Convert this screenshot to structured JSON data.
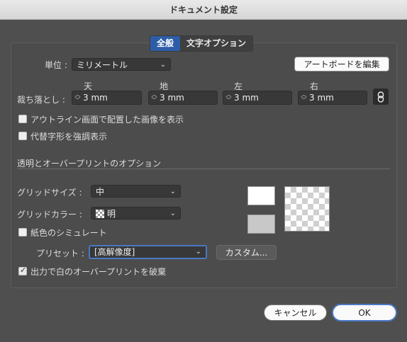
{
  "window": {
    "title": "ドキュメント設定"
  },
  "tabs": [
    {
      "label": "全般",
      "active": true
    },
    {
      "label": "文字オプション",
      "active": false
    }
  ],
  "units": {
    "label": "単位 :",
    "value": "ミリメートル"
  },
  "edit_artboards_button": "アートボードを編集",
  "bleed": {
    "label": "裁ち落とし :",
    "fields": [
      {
        "header": "天",
        "value": "3 mm"
      },
      {
        "header": "地",
        "value": "3 mm"
      },
      {
        "header": "左",
        "value": "3 mm"
      },
      {
        "header": "右",
        "value": "3 mm"
      }
    ],
    "link_icon": "chain-link-icon"
  },
  "checkboxes": {
    "show_images_outline": {
      "label": "アウトライン画面で配置した画像を表示",
      "checked": false
    },
    "highlight_substituted_glyphs": {
      "label": "代替字形を強調表示",
      "checked": false
    },
    "simulate_paper_color": {
      "label": "紙色のシミュレート",
      "checked": false
    },
    "discard_white_overprint": {
      "label": "出力で白のオーバープリントを破棄",
      "checked": true
    }
  },
  "transparency_section": {
    "heading": "透明とオーバープリントのオプション",
    "grid_size": {
      "label": "グリッドサイズ :",
      "value": "中"
    },
    "grid_color": {
      "label": "グリッドカラー :",
      "value": "明"
    },
    "preset": {
      "label": "プリセット :",
      "value": "[高解像度]"
    },
    "custom_button": "カスタム..."
  },
  "colors": {
    "accent": "#2e5da8",
    "swatch_top": "#ffffff",
    "swatch_bottom": "#c8c8c8"
  },
  "footer": {
    "cancel": "キャンセル",
    "ok": "OK"
  }
}
